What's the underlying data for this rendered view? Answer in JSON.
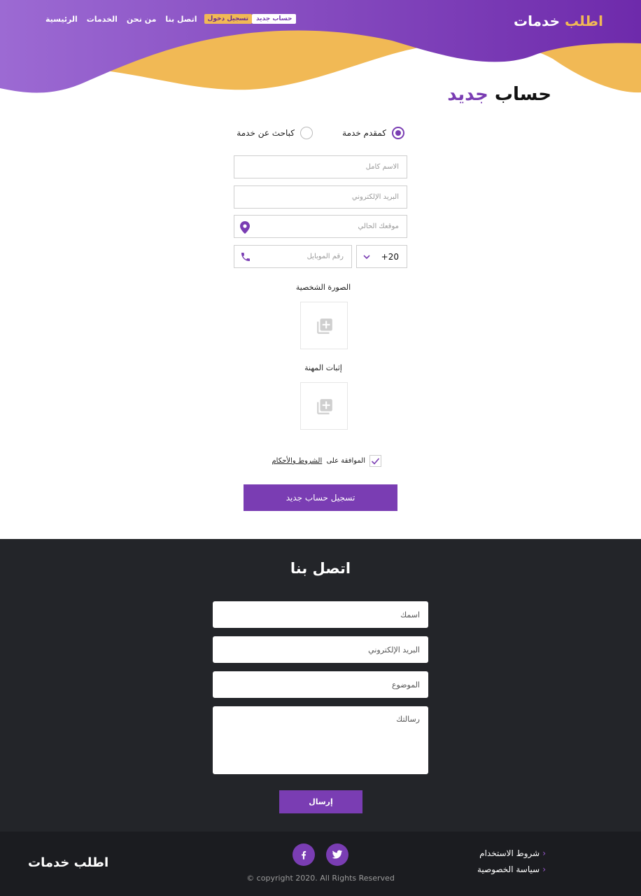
{
  "colors": {
    "primary": "#7a3db3",
    "accent": "#f1b955",
    "dark_bg": "#232529",
    "footer_bg": "#1b1c20"
  },
  "header": {
    "brand_part1": "اطلب",
    "brand_part2": "خدمات",
    "nav": [
      "الرئيسية",
      "الخدمات",
      "من نحن",
      "اتصل بنا"
    ],
    "login_label": "تسجيل دخول",
    "register_label": "حساب جديد"
  },
  "form": {
    "title_part1": "حساب",
    "title_part2": "جديد",
    "account_types": [
      {
        "label": "كمقدم خدمة",
        "selected": true
      },
      {
        "label": "كباحث عن خدمة",
        "selected": false
      }
    ],
    "placeholders": {
      "full_name": "الاسم كامل",
      "email": "البريد الإلكتروني",
      "location": "موقعك الحالي",
      "mobile": "رقم الموبايل"
    },
    "country_code": "20+",
    "profile_photo_label": "الصورة الشخصية",
    "profession_proof_label": "إثبات المهنة",
    "terms_prefix": "الموافقة على",
    "terms_link": "الشروط والأحكام",
    "terms_checked": true,
    "submit_label": "تسجيل حساب جديد"
  },
  "contact": {
    "title": "اتصل بنا",
    "placeholders": {
      "name": "اسمك",
      "email": "البريد الإلكتروني",
      "subject": "الموضوع",
      "message": "رسالتك"
    },
    "send_label": "إرسال"
  },
  "footer": {
    "brand": "اطلب خدمات",
    "copyright": "© copyright 2020. All Rights Reserved",
    "links": [
      "شروط الاستخدام",
      "سياسة الخصوصية"
    ],
    "social": [
      "facebook-icon",
      "twitter-icon"
    ]
  }
}
